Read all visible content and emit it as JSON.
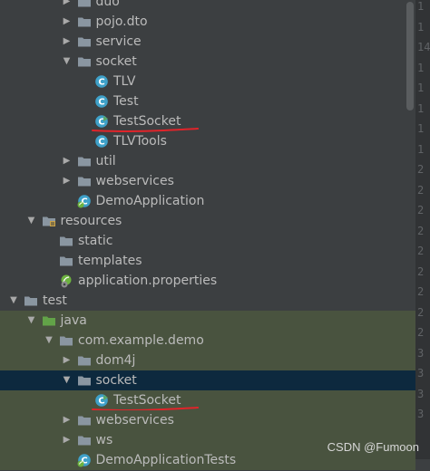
{
  "tree": {
    "rows": [
      {
        "label": "duo",
        "depth": 3,
        "arrow": "right",
        "icon": "folder",
        "state": "none"
      },
      {
        "label": "pojo.dto",
        "depth": 3,
        "arrow": "right",
        "icon": "folder",
        "state": "none"
      },
      {
        "label": "service",
        "depth": 3,
        "arrow": "right",
        "icon": "folder",
        "state": "none"
      },
      {
        "label": "socket",
        "depth": 3,
        "arrow": "down",
        "icon": "folder",
        "state": "none"
      },
      {
        "label": "TLV",
        "depth": 4,
        "arrow": "",
        "icon": "class",
        "state": "none"
      },
      {
        "label": "Test",
        "depth": 4,
        "arrow": "",
        "icon": "class",
        "state": "none"
      },
      {
        "label": "TestSocket",
        "depth": 4,
        "arrow": "",
        "icon": "runnable-class",
        "state": "none",
        "underline": true
      },
      {
        "label": "TLVTools",
        "depth": 4,
        "arrow": "",
        "icon": "class",
        "state": "none"
      },
      {
        "label": "util",
        "depth": 3,
        "arrow": "right",
        "icon": "folder",
        "state": "none"
      },
      {
        "label": "webservices",
        "depth": 3,
        "arrow": "right",
        "icon": "folder",
        "state": "none"
      },
      {
        "label": "DemoApplication",
        "depth": 3,
        "arrow": "",
        "icon": "spring-class",
        "state": "none"
      },
      {
        "label": "resources",
        "depth": 1,
        "arrow": "down",
        "icon": "resources-folder",
        "state": "none"
      },
      {
        "label": "static",
        "depth": 2,
        "arrow": "",
        "icon": "folder",
        "state": "none"
      },
      {
        "label": "templates",
        "depth": 2,
        "arrow": "",
        "icon": "folder",
        "state": "none"
      },
      {
        "label": "application.properties",
        "depth": 2,
        "arrow": "",
        "icon": "spring-properties",
        "state": "none"
      },
      {
        "label": "test",
        "depth": 0,
        "arrow": "down",
        "icon": "folder",
        "state": "none"
      },
      {
        "label": "java",
        "depth": 1,
        "arrow": "down",
        "icon": "test-folder",
        "state": "test"
      },
      {
        "label": "com.example.demo",
        "depth": 2,
        "arrow": "down",
        "icon": "folder",
        "state": "test"
      },
      {
        "label": "dom4j",
        "depth": 3,
        "arrow": "right",
        "icon": "folder",
        "state": "test"
      },
      {
        "label": "socket",
        "depth": 3,
        "arrow": "down",
        "icon": "folder",
        "state": "selected"
      },
      {
        "label": "TestSocket",
        "depth": 4,
        "arrow": "",
        "icon": "runnable-class",
        "state": "test",
        "underline": true
      },
      {
        "label": "webservices",
        "depth": 3,
        "arrow": "right",
        "icon": "folder",
        "state": "test"
      },
      {
        "label": "ws",
        "depth": 3,
        "arrow": "right",
        "icon": "folder",
        "state": "test"
      },
      {
        "label": "DemoApplicationTests",
        "depth": 3,
        "arrow": "",
        "icon": "spring-class",
        "state": "test"
      }
    ]
  },
  "gutter": {
    "line_numbers": [
      "1",
      "1",
      "14",
      "1",
      "1",
      "1",
      "1",
      "1",
      "2",
      "2",
      "2",
      "2",
      "2",
      "2",
      "2",
      "2",
      "2",
      "3",
      "3",
      "3",
      "3"
    ]
  },
  "watermark": "CSDN @Fumoon",
  "colors": {
    "background": "#3c3f41",
    "test_row": "#49533f",
    "selected_row": "#0d293e",
    "folder": "#8a96a1",
    "class_icon": "#3fa1c9",
    "underline": "#e0242a"
  }
}
